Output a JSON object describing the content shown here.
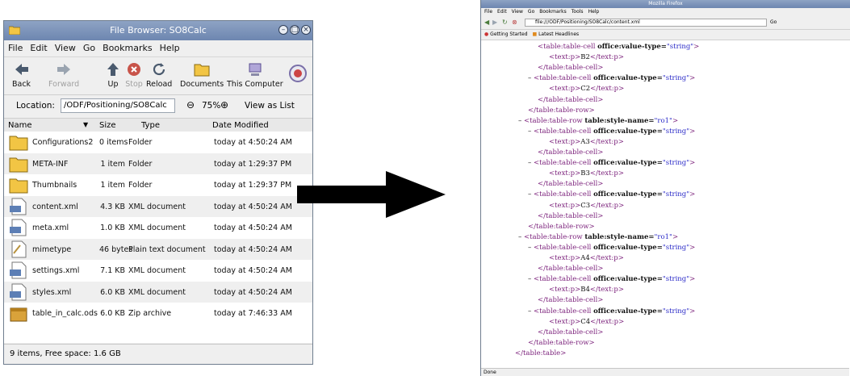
{
  "file_browser": {
    "title": "File Browser: SO8Calc",
    "menu": [
      "File",
      "Edit",
      "View",
      "Go",
      "Bookmarks",
      "Help"
    ],
    "toolbar": {
      "back": "Back",
      "forward": "Forward",
      "up": "Up",
      "stop": "Stop",
      "reload": "Reload",
      "documents": "Documents",
      "this_computer": "This Computer"
    },
    "location_label": "Location:",
    "location_value": "/ODF/Positioning/SO8Calc",
    "zoom_level": "75%",
    "view_as": "View as List",
    "columns": {
      "name": "Name",
      "size": "Size",
      "type": "Type",
      "date": "Date Modified"
    },
    "files": [
      {
        "name": "Configurations2",
        "size": "0 items",
        "type": "Folder",
        "date": "today at 4:50:24 AM",
        "icon": "folder-icon"
      },
      {
        "name": "META-INF",
        "size": "1 item",
        "type": "Folder",
        "date": "today at 1:29:37 PM",
        "icon": "folder-icon"
      },
      {
        "name": "Thumbnails",
        "size": "1 item",
        "type": "Folder",
        "date": "today at 1:29:37 PM",
        "icon": "folder-icon"
      },
      {
        "name": "content.xml",
        "size": "4.3 KB",
        "type": "XML document",
        "date": "today at 4:50:24 AM",
        "icon": "xml-document-icon"
      },
      {
        "name": "meta.xml",
        "size": "1.0 KB",
        "type": "XML document",
        "date": "today at 4:50:24 AM",
        "icon": "xml-document-icon"
      },
      {
        "name": "mimetype",
        "size": "46 bytes",
        "type": "Plain text document",
        "date": "today at 4:50:24 AM",
        "icon": "text-document-icon"
      },
      {
        "name": "settings.xml",
        "size": "7.1 KB",
        "type": "XML document",
        "date": "today at 4:50:24 AM",
        "icon": "xml-document-icon"
      },
      {
        "name": "styles.xml",
        "size": "6.0 KB",
        "type": "XML document",
        "date": "today at 4:50:24 AM",
        "icon": "xml-document-icon"
      },
      {
        "name": "table_in_calc.ods",
        "size": "6.0 KB",
        "type": "Zip archive",
        "date": "today at 7:46:33 AM",
        "icon": "zip-archive-icon"
      }
    ],
    "status": "9 items, Free space: 1.6 GB"
  },
  "browser": {
    "title": "Mozilla Firefox",
    "menu": [
      "File",
      "Edit",
      "View",
      "Go",
      "Bookmarks",
      "Tools",
      "Help"
    ],
    "url": "file:///ODF/Positioning/SO8Calc/content.xml",
    "go_label": "Go",
    "bookmarks": [
      "Getting Started",
      "Latest Headlines"
    ],
    "status": "Done",
    "xml_lines": [
      {
        "minus": "",
        "tag": "<table:table-cell ",
        "attr": "office:value-type=",
        "val": "\"string\"",
        "close": ">",
        "text": ""
      },
      {
        "minus": "",
        "tag": "<text:p>",
        "attr": "",
        "val": "",
        "close": "",
        "text": "B2",
        "end": "</text:p>"
      },
      {
        "minus": "",
        "tag": "</table:table-cell>",
        "attr": "",
        "val": "",
        "close": "",
        "text": ""
      },
      {
        "minus": "–",
        "tag": "<table:table-cell ",
        "attr": "office:value-type=",
        "val": "\"string\"",
        "close": ">",
        "text": ""
      },
      {
        "minus": "",
        "tag": "<text:p>",
        "attr": "",
        "val": "",
        "close": "",
        "text": "C2",
        "end": "</text:p>"
      },
      {
        "minus": "",
        "tag": "</table:table-cell>",
        "attr": "",
        "val": "",
        "close": "",
        "text": ""
      },
      {
        "minus": "",
        "tag": "</table:table-row>",
        "attr": "",
        "val": "",
        "close": "",
        "text": ""
      },
      {
        "minus": "–",
        "tag": "<table:table-row ",
        "attr": "table:style-name=",
        "val": "\"ro1\"",
        "close": ">",
        "text": ""
      },
      {
        "minus": "–",
        "tag": "<table:table-cell ",
        "attr": "office:value-type=",
        "val": "\"string\"",
        "close": ">",
        "text": ""
      },
      {
        "minus": "",
        "tag": "<text:p>",
        "attr": "",
        "val": "",
        "close": "",
        "text": "A3",
        "end": "</text:p>"
      },
      {
        "minus": "",
        "tag": "</table:table-cell>",
        "attr": "",
        "val": "",
        "close": "",
        "text": ""
      },
      {
        "minus": "–",
        "tag": "<table:table-cell ",
        "attr": "office:value-type=",
        "val": "\"string\"",
        "close": ">",
        "text": ""
      },
      {
        "minus": "",
        "tag": "<text:p>",
        "attr": "",
        "val": "",
        "close": "",
        "text": "B3",
        "end": "</text:p>"
      },
      {
        "minus": "",
        "tag": "</table:table-cell>",
        "attr": "",
        "val": "",
        "close": "",
        "text": ""
      },
      {
        "minus": "–",
        "tag": "<table:table-cell ",
        "attr": "office:value-type=",
        "val": "\"string\"",
        "close": ">",
        "text": ""
      },
      {
        "minus": "",
        "tag": "<text:p>",
        "attr": "",
        "val": "",
        "close": "",
        "text": "C3",
        "end": "</text:p>"
      },
      {
        "minus": "",
        "tag": "</table:table-cell>",
        "attr": "",
        "val": "",
        "close": "",
        "text": ""
      },
      {
        "minus": "",
        "tag": "</table:table-row>",
        "attr": "",
        "val": "",
        "close": "",
        "text": ""
      },
      {
        "minus": "–",
        "tag": "<table:table-row ",
        "attr": "table:style-name=",
        "val": "\"ro1\"",
        "close": ">",
        "text": ""
      },
      {
        "minus": "–",
        "tag": "<table:table-cell ",
        "attr": "office:value-type=",
        "val": "\"string\"",
        "close": ">",
        "text": ""
      },
      {
        "minus": "",
        "tag": "<text:p>",
        "attr": "",
        "val": "",
        "close": "",
        "text": "A4",
        "end": "</text:p>"
      },
      {
        "minus": "",
        "tag": "</table:table-cell>",
        "attr": "",
        "val": "",
        "close": "",
        "text": ""
      },
      {
        "minus": "–",
        "tag": "<table:table-cell ",
        "attr": "office:value-type=",
        "val": "\"string\"",
        "close": ">",
        "text": ""
      },
      {
        "minus": "",
        "tag": "<text:p>",
        "attr": "",
        "val": "",
        "close": "",
        "text": "B4",
        "end": "</text:p>"
      },
      {
        "minus": "",
        "tag": "</table:table-cell>",
        "attr": "",
        "val": "",
        "close": "",
        "text": ""
      },
      {
        "minus": "–",
        "tag": "<table:table-cell ",
        "attr": "office:value-type=",
        "val": "\"string\"",
        "close": ">",
        "text": ""
      },
      {
        "minus": "",
        "tag": "<text:p>",
        "attr": "",
        "val": "",
        "close": "",
        "text": "C4",
        "end": "</text:p>"
      },
      {
        "minus": "",
        "tag": "</table:table-cell>",
        "attr": "",
        "val": "",
        "close": "",
        "text": ""
      },
      {
        "minus": "",
        "tag": "</table:table-row>",
        "attr": "",
        "val": "",
        "close": "",
        "text": ""
      },
      {
        "minus": "",
        "tag": "</table:table>",
        "attr": "",
        "val": "",
        "close": "",
        "text": ""
      }
    ]
  },
  "colors": {
    "titlebar": "#7a91b8",
    "xml_tag": "#7a1f7a",
    "xml_value": "#2b2bc8",
    "arrow": "#000000"
  }
}
